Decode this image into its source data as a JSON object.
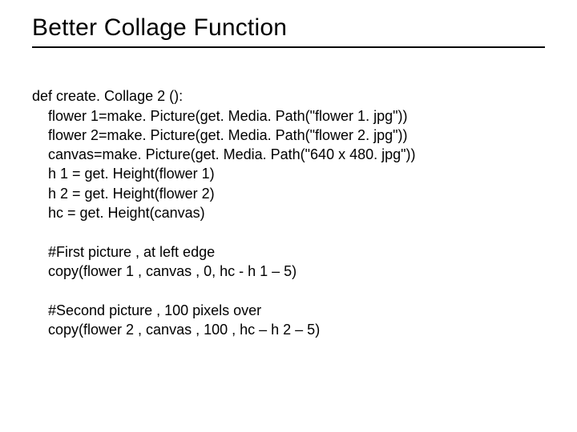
{
  "title": "Better Collage Function",
  "code": {
    "line1": "def create. Collage 2 ():",
    "line2": "    flower 1=make. Picture(get. Media. Path(\"flower 1. jpg\"))",
    "line3": "    flower 2=make. Picture(get. Media. Path(\"flower 2. jpg\"))",
    "line4": "    canvas=make. Picture(get. Media. Path(\"640 x 480. jpg\"))",
    "line5": "    h 1 = get. Height(flower 1)",
    "line6": "    h 2 = get. Height(flower 2)",
    "line7": "    hc = get. Height(canvas)",
    "blank1": "",
    "line8": "    #First picture , at left edge",
    "line9": "    copy(flower 1 , canvas , 0, hc - h 1 – 5)",
    "blank2": "",
    "line10": "    #Second picture , 100 pixels over",
    "line11": "    copy(flower 2 , canvas , 100 , hc – h 2 – 5)"
  }
}
